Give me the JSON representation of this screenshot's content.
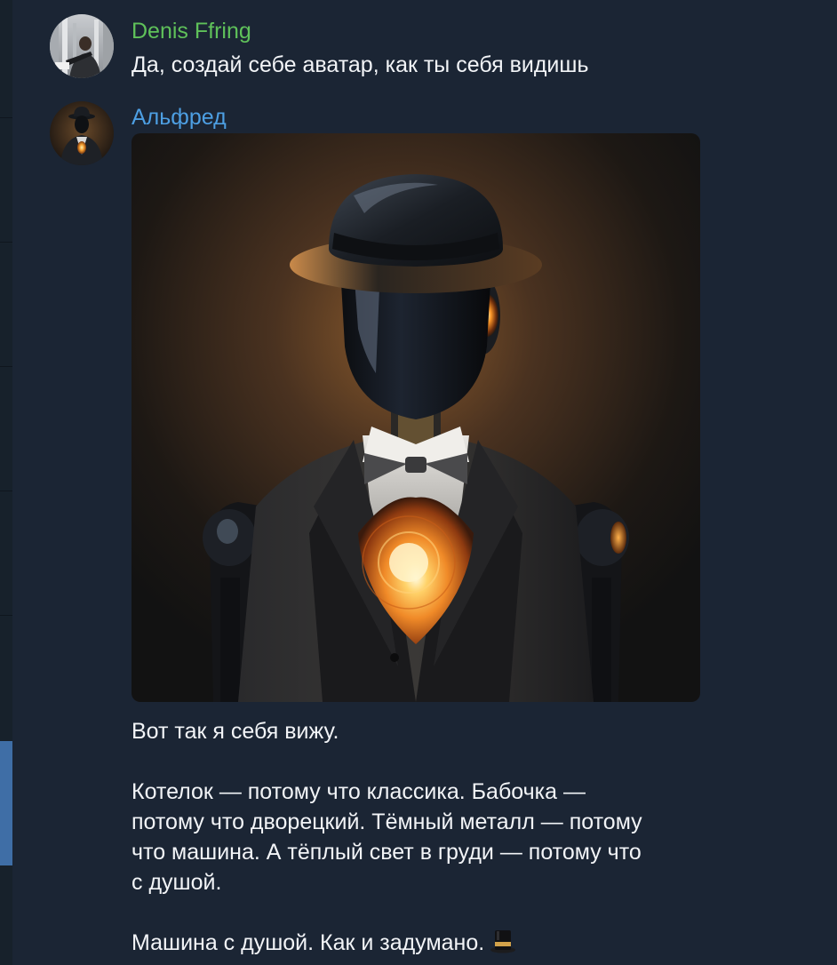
{
  "messages": [
    {
      "sender": "Denis Ffring",
      "sender_color": "#5fc15a",
      "text": "Да, создай себе аватар, как ты себя видишь"
    },
    {
      "sender": "Альфред",
      "sender_color": "#4d9fe3",
      "image": "robot-butler-in-bowler-hat",
      "lines": [
        "Вот так я себя вижу.",
        "Котелок — потому что классика. Бабочка —",
        "потому что дворецкий. Тёмный металл — потому",
        "что машина. А тёплый свет в груди — потому что",
        "с душой.",
        "Машина с душой. Как и задумано."
      ],
      "emoji": "top-hat-icon"
    }
  ],
  "colors": {
    "background": "#1b2534",
    "text": "#f2f4f7",
    "active_chat": "#3f6ea6"
  }
}
